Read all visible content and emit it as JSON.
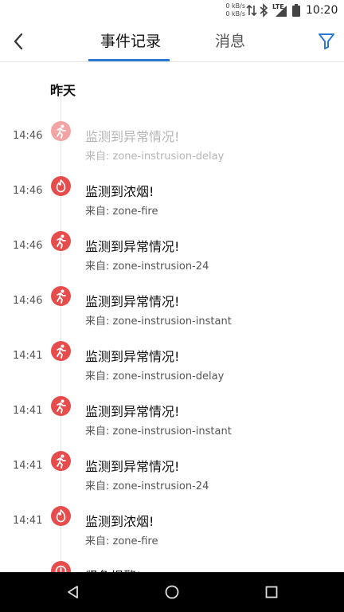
{
  "status_bar": {
    "net_speed_up": "0 kB/s",
    "net_speed_down": "0 kB/s",
    "network": "LTE",
    "time": "10:20",
    "icons": [
      "data-arrows-icon",
      "bluetooth-icon",
      "signal-icon",
      "battery-icon"
    ]
  },
  "header": {
    "back_icon": "back-arrow-icon",
    "tabs": [
      {
        "label": "事件记录",
        "active": true
      },
      {
        "label": "消息",
        "active": false
      }
    ],
    "filter_icon": "filter-icon",
    "accent_color": "#2a7ad3"
  },
  "events_list": {
    "day_label": "昨天",
    "items": [
      {
        "time": "14:46",
        "title": "监测到异常情况!",
        "source": "来自: zone-instrusion-delay",
        "icon": "intruder-running-icon",
        "faded": true
      },
      {
        "time": "14:46",
        "title": "监测到浓烟!",
        "source": "来自: zone-fire",
        "icon": "fire-icon",
        "faded": false
      },
      {
        "time": "14:46",
        "title": "监测到异常情况!",
        "source": "来自: zone-instrusion-24",
        "icon": "intruder-running-icon",
        "faded": false
      },
      {
        "time": "14:46",
        "title": "监测到异常情况!",
        "source": "来自: zone-instrusion-instant",
        "icon": "intruder-running-icon",
        "faded": false
      },
      {
        "time": "14:41",
        "title": "监测到异常情况!",
        "source": "来自: zone-instrusion-delay",
        "icon": "intruder-running-icon",
        "faded": false
      },
      {
        "time": "14:41",
        "title": "监测到异常情况!",
        "source": "来自: zone-instrusion-instant",
        "icon": "intruder-running-icon",
        "faded": false
      },
      {
        "time": "14:41",
        "title": "监测到异常情况!",
        "source": "来自: zone-instrusion-24",
        "icon": "intruder-running-icon",
        "faded": false
      },
      {
        "time": "14:41",
        "title": "监测到浓烟!",
        "source": "来自: zone-fire",
        "icon": "fire-icon",
        "faded": false
      },
      {
        "time": "",
        "title": "紧急报警!",
        "source": "",
        "icon": "emergency-alarm-icon",
        "faded": false
      }
    ],
    "alert_color": "#e74c4c"
  },
  "nav_bar": {
    "buttons": [
      "nav-back-icon",
      "nav-home-icon",
      "nav-recents-icon"
    ]
  }
}
